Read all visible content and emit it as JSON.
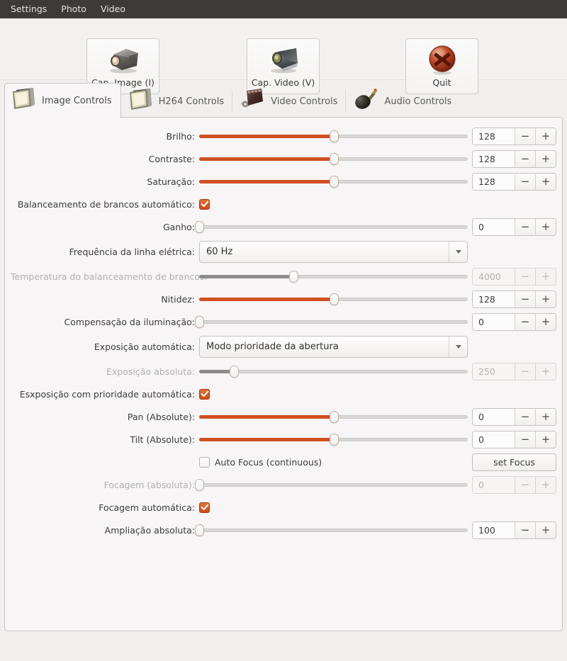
{
  "menubar": {
    "items": [
      {
        "label": "Settings",
        "name": "menu-settings"
      },
      {
        "label": "Photo",
        "name": "menu-photo"
      },
      {
        "label": "Video",
        "name": "menu-video"
      }
    ]
  },
  "toolbar": {
    "capture_image_label": "Cap. Image (I)",
    "capture_video_label": "Cap. Video (V)",
    "quit_label": "Quit",
    "capture_image_icon": "photo-camera-icon",
    "capture_video_icon": "video-camera-icon",
    "quit_icon": "quit-cross-icon"
  },
  "tabs": [
    {
      "label": "Image Controls",
      "icon": "monitor-icon",
      "active": true
    },
    {
      "label": "H264 Controls",
      "icon": "monitor-icon",
      "active": false
    },
    {
      "label": "Video Controls",
      "icon": "film-icon",
      "active": false
    },
    {
      "label": "Audio Controls",
      "icon": "microphone-icon",
      "active": false
    }
  ],
  "colors": {
    "accent": "#d14f21",
    "menubar_bg": "#3c3b37",
    "panel_bg": "#f7f5f6",
    "window_bg": "#f0efee",
    "disabled_text": "#b3b0ae"
  },
  "controls": [
    {
      "kind": "slider",
      "name": "brilho",
      "label": "Brilho:",
      "value": "128",
      "percent": 50,
      "disabled": false,
      "filled": true
    },
    {
      "kind": "slider",
      "name": "contraste",
      "label": "Contraste:",
      "value": "128",
      "percent": 50,
      "disabled": false,
      "filled": true
    },
    {
      "kind": "slider",
      "name": "saturacao",
      "label": "Saturação:",
      "value": "128",
      "percent": 50,
      "disabled": false,
      "filled": true
    },
    {
      "kind": "checkbox",
      "name": "balanceamento-brancos-automatico",
      "label": "Balanceamento de brancos automático:",
      "checked": true,
      "disabled": false
    },
    {
      "kind": "slider",
      "name": "ganho",
      "label": "Ganho:",
      "value": "0",
      "percent": 0,
      "disabled": false,
      "filled": true
    },
    {
      "kind": "combo",
      "name": "frequencia-linha-eletrica",
      "label": "Frequência da linha elétrica:",
      "value": "60 Hz",
      "disabled": false
    },
    {
      "kind": "slider",
      "name": "temperatura-balanceamento-brancos",
      "label": "Temperatura do balanceamento de brancos:",
      "value": "4000",
      "percent": 35,
      "disabled": true,
      "filled": true
    },
    {
      "kind": "slider",
      "name": "nitidez",
      "label": "Nitidez:",
      "value": "128",
      "percent": 50,
      "disabled": false,
      "filled": true
    },
    {
      "kind": "slider",
      "name": "compensacao-iluminacao",
      "label": "Compensação da iluminação:",
      "value": "0",
      "percent": 0,
      "disabled": false,
      "filled": true
    },
    {
      "kind": "combo",
      "name": "exposicao-automatica",
      "label": "Exposição automática:",
      "value": "Modo prioridade da abertura",
      "disabled": false
    },
    {
      "kind": "slider",
      "name": "exposicao-absoluta",
      "label": "Exposição absoluta:",
      "value": "250",
      "percent": 13,
      "disabled": true,
      "filled": true
    },
    {
      "kind": "checkbox",
      "name": "exposicao-prioridade-automatica",
      "label": "Esxposição com prioridade automática:",
      "checked": true,
      "disabled": false
    },
    {
      "kind": "slider",
      "name": "pan-absolute",
      "label": "Pan (Absolute):",
      "value": "0",
      "percent": 50,
      "disabled": false,
      "filled": true
    },
    {
      "kind": "slider",
      "name": "tilt-absolute",
      "label": "Tilt (Absolute):",
      "value": "0",
      "percent": 50,
      "disabled": false,
      "filled": true
    },
    {
      "kind": "checkbox-button",
      "name": "auto-focus-continuous",
      "label": "",
      "checkbox_label": "Auto Focus (continuous)",
      "checked": false,
      "button_label": "set Focus",
      "disabled": false
    },
    {
      "kind": "slider",
      "name": "focagem-absoluta",
      "label": "Focagem (absoluta):",
      "value": "0",
      "percent": 0,
      "disabled": true,
      "filled": true
    },
    {
      "kind": "checkbox",
      "name": "focagem-automatica",
      "label": "Focagem automática:",
      "checked": true,
      "disabled": false
    },
    {
      "kind": "slider",
      "name": "ampliacao-absoluta",
      "label": "Ampliação absoluta:",
      "value": "100",
      "percent": 0,
      "disabled": false,
      "filled": true
    }
  ],
  "spin": {
    "minus": "−",
    "plus": "+"
  }
}
